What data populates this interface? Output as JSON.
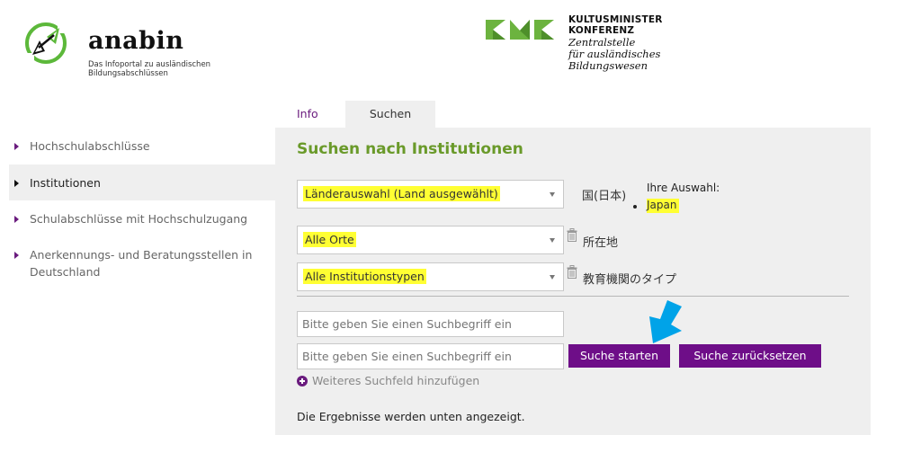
{
  "header": {
    "anabin": {
      "wordmark": "anabin",
      "tagline_line1": "Das Infoportal zu ausländischen",
      "tagline_line2": "Bildungsabschlüssen",
      "logo_icon": "compass-logo-icon"
    },
    "kmk": {
      "title_line1": "KULTUSMINISTER",
      "title_line2": "KONFERENZ",
      "sub_line1": "Zentralstelle",
      "sub_line2": "für ausländisches",
      "sub_line3": "Bildungswesen",
      "logo_icon": "kmk-logo-icon"
    }
  },
  "sidebar": {
    "items": [
      {
        "label": "Hochschulabschlüsse",
        "active": false
      },
      {
        "label": "Institutionen",
        "active": true
      },
      {
        "label": "Schulabschlüsse mit Hochschulzugang",
        "active": false
      },
      {
        "label": "Anerkennungs- und Beratungsstellen in Deutschland",
        "active": false
      }
    ]
  },
  "tabs": [
    {
      "label": "Info",
      "active": false
    },
    {
      "label": "Suchen",
      "active": true
    }
  ],
  "panel": {
    "title": "Suchen nach Institutionen",
    "country_select": {
      "value": "Länderauswahl (Land ausgewählt)",
      "annotation": "国(日本)"
    },
    "your_selection": {
      "heading": "Ihre Auswahl:",
      "items": [
        "Japan"
      ]
    },
    "location_select": {
      "value": "Alle Orte",
      "annotation": "所在地"
    },
    "type_select": {
      "value": "Alle Institutionstypen",
      "annotation": "教育機関のタイプ"
    },
    "search_fields": [
      {
        "value": "",
        "placeholder": "Bitte geben Sie einen Suchbegriff ein"
      },
      {
        "value": "",
        "placeholder": "Bitte geben Sie einen Suchbegriff ein"
      }
    ],
    "start_button": "Suche starten",
    "reset_button": "Suche zurücksetzen",
    "add_field_link": "Weiteres Suchfeld hinzufügen",
    "result_note": "Die Ergebnisse werden unten angezeigt."
  },
  "colors": {
    "accent_purple": "#6e0e88",
    "title_green": "#6a9a2a",
    "highlight_yellow": "#ffff33",
    "panel_gray": "#efefef",
    "annotation_arrow_blue": "#00a3e8"
  }
}
